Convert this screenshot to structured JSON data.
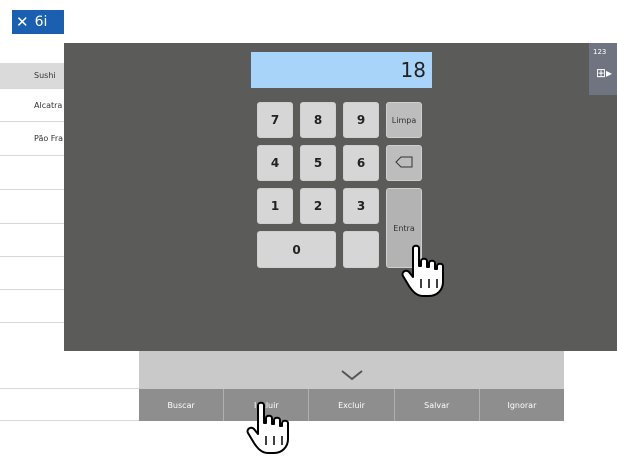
{
  "header": {
    "close_label": "6i",
    "title_fragment": ""
  },
  "list": {
    "items": [
      {
        "label": "Sushi",
        "selected": true
      },
      {
        "label": "Alcatra"
      },
      {
        "label": "Pão Fra"
      },
      {
        "label": ""
      },
      {
        "label": ""
      },
      {
        "label": ""
      },
      {
        "label": ""
      },
      {
        "label": ""
      },
      {
        "label": ""
      },
      {
        "label": ""
      }
    ]
  },
  "keypad": {
    "display_value": "18",
    "keys": {
      "k7": "7",
      "k8": "8",
      "k9": "9",
      "k4": "4",
      "k5": "5",
      "k6": "6",
      "k1": "1",
      "k2": "2",
      "k3": "3",
      "k0": "0",
      "blank": ""
    },
    "clear_label": "Limpa",
    "enter_label": "Entra"
  },
  "side_panel": {
    "label": "123"
  },
  "toolbar": {
    "buttons": [
      "Buscar",
      "Incluir",
      "Excluir",
      "Salvar",
      "Ignorar"
    ]
  },
  "colors": {
    "accent": "#1b5fb0",
    "overlay": "#5b5b5a",
    "display_bg": "#a9d4fa"
  },
  "icons": [
    "close-icon",
    "backspace-icon",
    "chevron-down-icon",
    "keypad-toggle-icon",
    "hand-pointer-icon"
  ]
}
